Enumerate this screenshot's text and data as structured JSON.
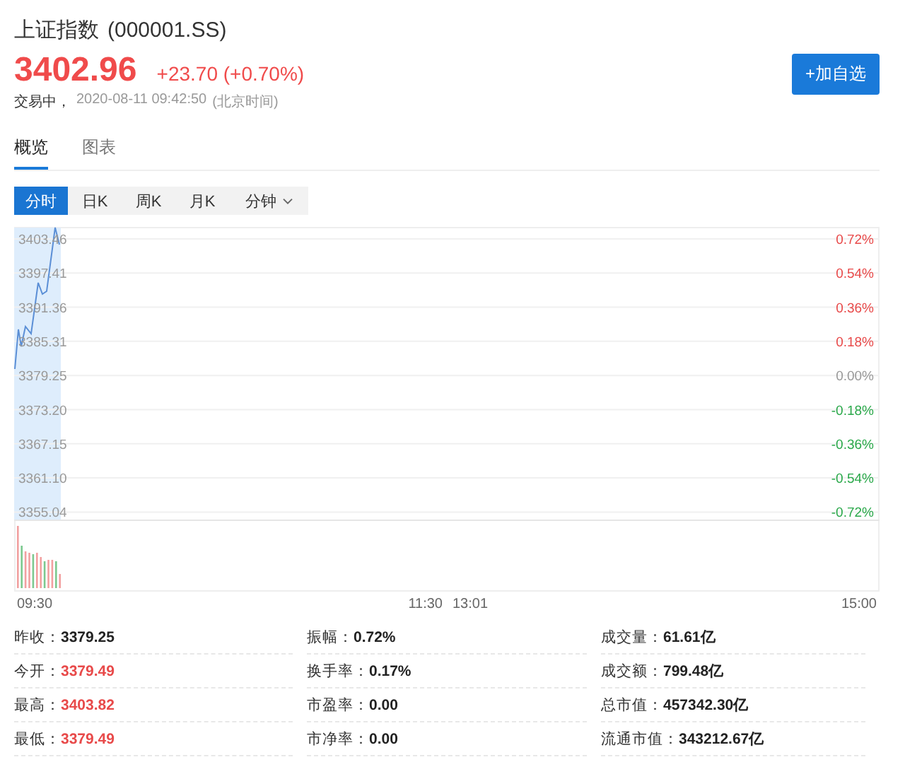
{
  "header": {
    "title": "上证指数",
    "code": "(000001.SS)",
    "price": "3402.96",
    "change": "+23.70 (+0.70%)",
    "status": "交易中，",
    "time": "2020-08-11 09:42:50",
    "timezone": "(北京时间)",
    "watch_button": "+加自选"
  },
  "tabs": [
    {
      "label": "概览",
      "selected": true
    },
    {
      "label": "图表",
      "selected": false
    }
  ],
  "periods": [
    {
      "label": "分时",
      "selected": true,
      "dropdown": false
    },
    {
      "label": "日K",
      "selected": false,
      "dropdown": false
    },
    {
      "label": "周K",
      "selected": false,
      "dropdown": false
    },
    {
      "label": "月K",
      "selected": false,
      "dropdown": false
    },
    {
      "label": "分钟",
      "selected": false,
      "dropdown": true
    }
  ],
  "chart": {
    "price_labels": [
      "3403.46",
      "3397.41",
      "3391.36",
      "3385.31",
      "3379.25",
      "3373.20",
      "3367.15",
      "3361.10",
      "3355.04"
    ],
    "percent_labels": [
      {
        "label": "0.72%",
        "color": "#e84a4a"
      },
      {
        "label": "0.54%",
        "color": "#e84a4a"
      },
      {
        "label": "0.36%",
        "color": "#e84a4a"
      },
      {
        "label": "0.18%",
        "color": "#e84a4a"
      },
      {
        "label": "0.00%",
        "color": "#999999"
      },
      {
        "label": "-0.18%",
        "color": "#2aa84a"
      },
      {
        "label": "-0.36%",
        "color": "#2aa84a"
      },
      {
        "label": "-0.54%",
        "color": "#2aa84a"
      },
      {
        "label": "-0.72%",
        "color": "#2aa84a"
      }
    ],
    "time_labels": [
      "09:30",
      "11:30",
      "13:01",
      "15:00"
    ]
  },
  "stats": [
    {
      "label": "昨收：",
      "value": "3379.25",
      "color": "#222222"
    },
    {
      "label": "振幅：",
      "value": "0.72%",
      "color": "#222222"
    },
    {
      "label": "成交量：",
      "value": "61.61亿",
      "color": "#222222"
    },
    {
      "label": "今开：",
      "value": "3379.49",
      "color": "#e84a4a"
    },
    {
      "label": "换手率：",
      "value": "0.17%",
      "color": "#222222"
    },
    {
      "label": "成交额：",
      "value": "799.48亿",
      "color": "#222222"
    },
    {
      "label": "最高：",
      "value": "3403.82",
      "color": "#e84a4a"
    },
    {
      "label": "市盈率：",
      "value": "0.00",
      "color": "#222222"
    },
    {
      "label": "总市值：",
      "value": "457342.30亿",
      "color": "#222222"
    },
    {
      "label": "最低：",
      "value": "3379.49",
      "color": "#e84a4a"
    },
    {
      "label": "市净率：",
      "value": "0.00",
      "color": "#222222"
    },
    {
      "label": "流通市值：",
      "value": "343212.67亿",
      "color": "#222222"
    }
  ]
}
